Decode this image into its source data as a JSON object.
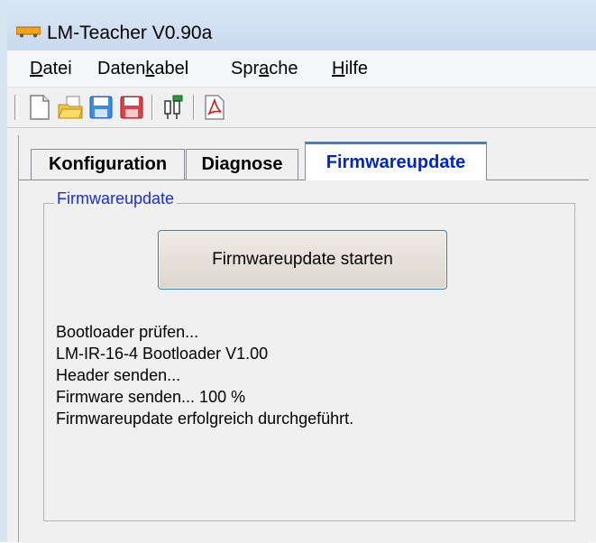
{
  "window": {
    "title": "LM-Teacher V0.90a"
  },
  "menu": {
    "items": [
      {
        "pre": "",
        "u": "D",
        "post": "atei"
      },
      {
        "pre": "Daten",
        "u": "k",
        "post": "abel"
      },
      {
        "pre": "Spr",
        "u": "a",
        "post": "che"
      },
      {
        "pre": "",
        "u": "H",
        "post": "ilfe"
      }
    ]
  },
  "toolbar": {
    "icons": [
      "new-file-icon",
      "open-folder-icon",
      "save-icon",
      "save-as-icon",
      "data-cable-icon",
      "pdf-icon"
    ]
  },
  "tabs": [
    {
      "label": "Konfiguration",
      "active": false
    },
    {
      "label": "Diagnose",
      "active": false
    },
    {
      "label": "Firmwareupdate",
      "active": true
    }
  ],
  "group": {
    "title": "Firmwareupdate",
    "button_label": "Firmwareupdate starten"
  },
  "log_lines": [
    "Bootloader prüfen...",
    "LM-IR-16-4 Bootloader V1.00",
    "Header senden...",
    "Firmware senden... 100 %",
    "Firmwareupdate erfolgreich durchgeführt."
  ],
  "colors": {
    "active_tab_text": "#0026c8",
    "group_title": "#1b2ed0",
    "button_border": "#3c7fb1"
  }
}
